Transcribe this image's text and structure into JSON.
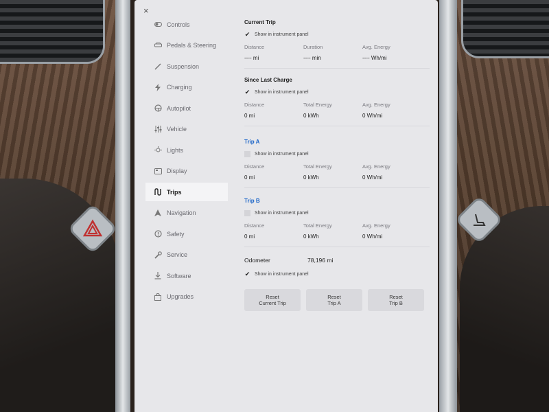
{
  "sidebar": {
    "items": [
      {
        "label": "Controls",
        "icon": "toggle-icon"
      },
      {
        "label": "Pedals & Steering",
        "icon": "car-icon"
      },
      {
        "label": "Suspension",
        "icon": "suspension-icon"
      },
      {
        "label": "Charging",
        "icon": "bolt-icon"
      },
      {
        "label": "Autopilot",
        "icon": "steering-wheel-icon"
      },
      {
        "label": "Vehicle",
        "icon": "sliders-icon"
      },
      {
        "label": "Lights",
        "icon": "light-icon"
      },
      {
        "label": "Display",
        "icon": "display-icon"
      },
      {
        "label": "Trips",
        "icon": "trips-icon",
        "active": true
      },
      {
        "label": "Navigation",
        "icon": "navigation-icon"
      },
      {
        "label": "Safety",
        "icon": "safety-icon"
      },
      {
        "label": "Service",
        "icon": "wrench-icon"
      },
      {
        "label": "Software",
        "icon": "download-icon"
      },
      {
        "label": "Upgrades",
        "icon": "bag-icon"
      }
    ]
  },
  "current_trip": {
    "title": "Current Trip",
    "show_label": "Show in instrument panel",
    "checked": true,
    "stats": [
      {
        "label": "Distance",
        "value": "---- mi"
      },
      {
        "label": "Duration",
        "value": "---- min"
      },
      {
        "label": "Avg. Energy",
        "value": "---- Wh/mi"
      }
    ]
  },
  "since_last_charge": {
    "title": "Since Last Charge",
    "show_label": "Show in instrument panel",
    "checked": true,
    "stats": [
      {
        "label": "Distance",
        "value": "0 mi"
      },
      {
        "label": "Total Energy",
        "value": "0 kWh"
      },
      {
        "label": "Avg. Energy",
        "value": "0 Wh/mi"
      }
    ]
  },
  "trip_a": {
    "title": "Trip A",
    "show_label": "Show in instrument panel",
    "checked": false,
    "stats": [
      {
        "label": "Distance",
        "value": "0 mi"
      },
      {
        "label": "Total Energy",
        "value": "0 kWh"
      },
      {
        "label": "Avg. Energy",
        "value": "0 Wh/mi"
      }
    ]
  },
  "trip_b": {
    "title": "Trip B",
    "show_label": "Show in instrument panel",
    "checked": false,
    "stats": [
      {
        "label": "Distance",
        "value": "0 mi"
      },
      {
        "label": "Total Energy",
        "value": "0 kWh"
      },
      {
        "label": "Avg. Energy",
        "value": "0 Wh/mi"
      }
    ]
  },
  "odometer": {
    "label": "Odometer",
    "value": "78,196 mi",
    "show_label": "Show in instrument panel",
    "checked": true
  },
  "buttons": {
    "reset_current": [
      "Reset",
      "Current Trip"
    ],
    "reset_a": [
      "Reset",
      "Trip A"
    ],
    "reset_b": [
      "Reset",
      "Trip B"
    ]
  },
  "close_icon": "×"
}
